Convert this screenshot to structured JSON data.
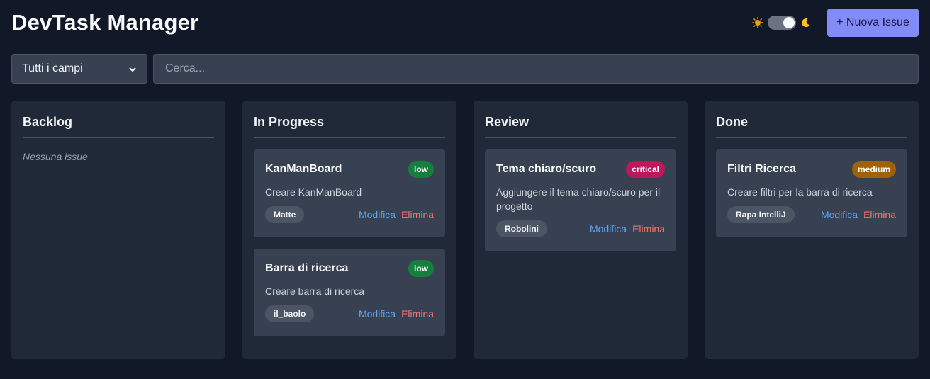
{
  "app": {
    "title": "DevTask Manager"
  },
  "header": {
    "new_issue_label": "+ Nuova Issue",
    "theme_toggle": {
      "mode": "dark",
      "sun_icon": "sun-icon",
      "moon_icon": "moon-icon"
    }
  },
  "filters": {
    "field_select_value": "Tutti i campi",
    "search_placeholder": "Cerca...",
    "search_value": ""
  },
  "colors": {
    "accent": "#818cf8",
    "low": "#15803d",
    "critical": "#be185d",
    "medium": "#a16207",
    "edit": "#60a5fa",
    "delete": "#f87171"
  },
  "columns": [
    {
      "title": "Backlog",
      "empty_text": "Nessuna issue",
      "cards": []
    },
    {
      "title": "In Progress",
      "cards": [
        {
          "title": "KanManBoard",
          "priority": "low",
          "description": "Creare KanManBoard",
          "assignee": "Matte",
          "edit_label": "Modifica",
          "delete_label": "Elimina"
        },
        {
          "title": "Barra di ricerca",
          "priority": "low",
          "description": "Creare barra di ricerca",
          "assignee": "il_baolo",
          "edit_label": "Modifica",
          "delete_label": "Elimina"
        }
      ]
    },
    {
      "title": "Review",
      "cards": [
        {
          "title": "Tema chiaro/scuro",
          "priority": "critical",
          "description": "Aggiungere il tema chiaro/scuro per il progetto",
          "assignee": "Robolini",
          "edit_label": "Modifica",
          "delete_label": "Elimina"
        }
      ]
    },
    {
      "title": "Done",
      "cards": [
        {
          "title": "Filtri Ricerca",
          "priority": "medium",
          "description": "Creare filtri per la barra di ricerca",
          "assignee": "Rapa IntelliJ",
          "edit_label": "Modifica",
          "delete_label": "Elimina"
        }
      ]
    }
  ]
}
